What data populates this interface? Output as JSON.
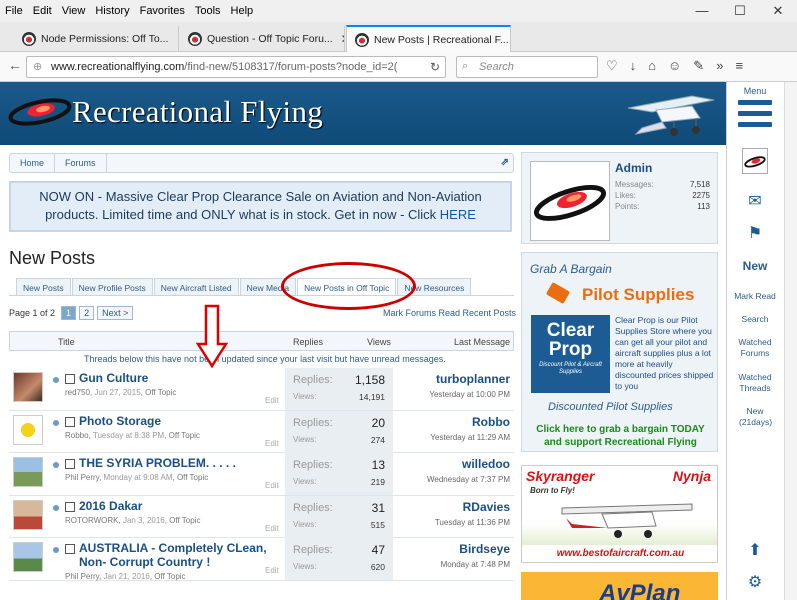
{
  "window": {
    "menu": [
      "File",
      "Edit",
      "View",
      "History",
      "Favorites",
      "Tools",
      "Help"
    ],
    "controls": [
      "—",
      "☐",
      "✕"
    ]
  },
  "browser": {
    "tabs": [
      {
        "label": "Node Permissions: Off To...",
        "active": false
      },
      {
        "label": "Question - Off Topic Foru...",
        "active": false
      },
      {
        "label": "New Posts | Recreational F...",
        "active": true
      }
    ],
    "url_domain": "www.recreationalflying.com",
    "url_path": "/find-new/5108317/forum-posts?node_id=2(",
    "search_placeholder": "Search"
  },
  "site": {
    "title": "Recreational Flying"
  },
  "breadcrumb": [
    "Home",
    "Forums"
  ],
  "banner": {
    "text": "NOW ON - Massive Clear Prop Clearance Sale on Aviation and Non-Aviation products. Limited time and ONLY what is in stock. Get in now - Click ",
    "link": "HERE"
  },
  "page_title": "New Posts",
  "tabs": [
    "New Posts",
    "New Profile Posts",
    "New Aircraft Listed",
    "New Media",
    "New Posts in Off Topic",
    "New Resources"
  ],
  "pager": {
    "label": "Page 1 of 2",
    "pages": [
      "1",
      "2"
    ],
    "next": "Next >",
    "links": "Mark Forums Read   Recent Posts"
  },
  "columns": {
    "title": "Title",
    "replies": "Replies",
    "views": "Views",
    "last": "Last Message"
  },
  "unread_note": "Threads below this have not been updated since your last visit but have unread messages.",
  "labels": {
    "replies": "Replies:",
    "views": "Views:",
    "edit": "Edit"
  },
  "threads": [
    {
      "title": "Gun Culture",
      "author": "red750",
      "date": "Jun 27, 2015",
      "forum": "Off Topic",
      "replies": "1,158",
      "views": "14,191",
      "last_user": "turboplanner",
      "last_time": "Yesterday at 10:00 PM"
    },
    {
      "title": "Photo Storage",
      "author": "Robbo",
      "date": "Tuesday at 8:38 PM",
      "forum": "Off Topic",
      "replies": "20",
      "views": "274",
      "last_user": "Robbo",
      "last_time": "Yesterday at 11:29 AM"
    },
    {
      "title": "THE SYRIA PROBLEM. . . . .",
      "author": "Phil Perry",
      "date": "Monday at 9:08 AM",
      "forum": "Off Topic",
      "replies": "13",
      "views": "219",
      "last_user": "willedoo",
      "last_time": "Wednesday at 7:37 PM"
    },
    {
      "title": "2016 Dakar",
      "author": "ROTORWORK",
      "date": "Jan 3, 2016",
      "forum": "Off Topic",
      "replies": "31",
      "views": "515",
      "last_user": "RDavies",
      "last_time": "Tuesday at 11:36 PM"
    },
    {
      "title": "AUSTRALIA - Completely CLean, Non- Corrupt Country !",
      "author": "Phil Perry",
      "date": "Jan 21, 2016",
      "forum": "Off Topic",
      "replies": "47",
      "views": "620",
      "last_user": "Birdseye",
      "last_time": "Monday at 7:48 PM"
    }
  ],
  "profile": {
    "name": "Admin",
    "messages_label": "Messages:",
    "messages": "7,518",
    "likes_label": "Likes:",
    "likes": "2275",
    "points_label": "Points:",
    "points": "113"
  },
  "bargain": {
    "heading": "Grab A Bargain",
    "brand": "Pilot Supplies",
    "cp_line1": "Clear",
    "cp_line2": "Prop",
    "cp_sub": "Discount Pilot & Aircraft Supplies",
    "desc": "Clear Prop is our Pilot Supplies Store where you can get all your pilot and aircraft supplies plus a lot more at heavily discounted prices shipped to you",
    "discounted": "Discounted Pilot Supplies",
    "cta": "Click here to grab a bargain TODAY and support Recreational Flying"
  },
  "ad1": {
    "left": "Skyranger",
    "right": "Nynja",
    "tagline": "Born to Fly!",
    "url": "www.bestofaircraft.com.au"
  },
  "ad2": {
    "text": "AvPlan"
  },
  "right_nav": {
    "menu": "Menu",
    "new": "New",
    "links": [
      "Mark Read",
      "Search",
      "Watched Forums",
      "Watched Threads",
      "New (21days)"
    ]
  }
}
